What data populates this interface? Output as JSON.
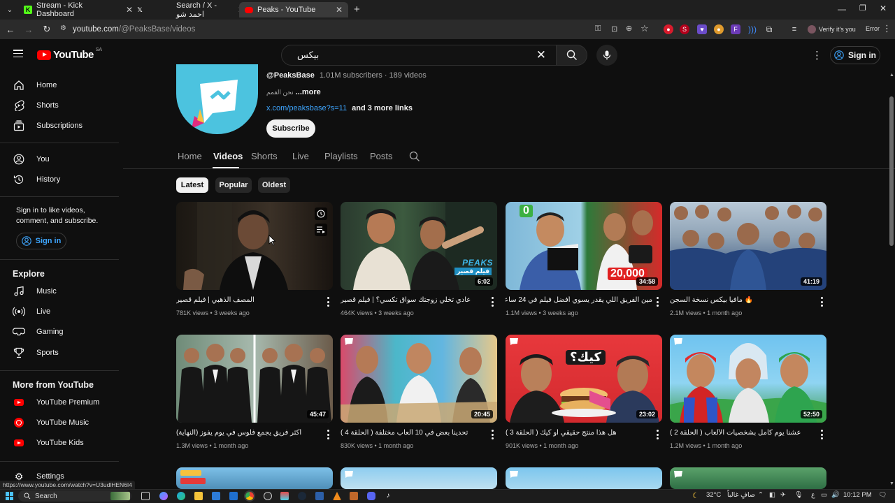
{
  "browser": {
    "tabs": [
      {
        "label": "Stream - Kick Dashboard",
        "favicon": "kick-icon",
        "color": "#53fc18"
      },
      {
        "label": "Search / X - احمد شو",
        "favicon": "x-icon",
        "color": "#ffffff"
      },
      {
        "label": "Peaks - YouTube",
        "favicon": "youtube-icon",
        "color": "#ff0000"
      }
    ],
    "url_host": "youtube.com",
    "url_path": "/@PeaksBase/videos",
    "profile_label": "Verify it's you",
    "error_label": "Error"
  },
  "header": {
    "logo_text": "YouTube",
    "region": "SA",
    "search_value": "بيكس",
    "signin_label": "Sign in"
  },
  "sidebar": {
    "main": [
      {
        "label": "Home",
        "icon": "home-icon"
      },
      {
        "label": "Shorts",
        "icon": "shorts-icon"
      },
      {
        "label": "Subscriptions",
        "icon": "subscriptions-icon"
      }
    ],
    "you": [
      {
        "label": "You",
        "icon": "you-icon"
      },
      {
        "label": "History",
        "icon": "history-icon"
      }
    ],
    "signin_prompt": "Sign in to like videos, comment, and subscribe.",
    "signin_label": "Sign in",
    "explore_title": "Explore",
    "explore": [
      {
        "label": "Music",
        "icon": "music-icon"
      },
      {
        "label": "Live",
        "icon": "live-icon"
      },
      {
        "label": "Gaming",
        "icon": "gaming-icon"
      },
      {
        "label": "Sports",
        "icon": "sports-icon"
      }
    ],
    "more_title": "More from YouTube",
    "more": [
      {
        "label": "YouTube Premium"
      },
      {
        "label": "YouTube Music"
      },
      {
        "label": "YouTube Kids"
      }
    ],
    "settings_label": "Settings"
  },
  "channel": {
    "handle": "@PeaksBase",
    "stats": "1.01M subscribers · 189 videos",
    "description": "نحن القمم",
    "more_label": "...more",
    "link": "x.com/peaksbase?s=11",
    "more_links": "and 3 more links",
    "subscribe_label": "Subscribe",
    "tabs": [
      "Home",
      "Videos",
      "Shorts",
      "Live",
      "Playlists",
      "Posts"
    ],
    "active_tab": "Videos"
  },
  "filters": [
    "Latest",
    "Popular",
    "Oldest"
  ],
  "videos": [
    {
      "title": "المصف الذهبي | فيلم قصير",
      "meta": "781K views • 3 weeks ago",
      "duration": ""
    },
    {
      "title": "عادي تخلي زوجتك سواق تكسي؟ | فيلم قصير",
      "meta": "464K views • 3 weeks ago",
      "duration": "6:02",
      "badge": "PEAKS",
      "badge_sub": "فيلم قصير"
    },
    {
      "title": "مين الفريق اللي يقدر يسوي أفضل فيلم في 24 ساعة ؟",
      "meta": "1.1M views • 3 weeks ago",
      "duration": "34:58",
      "price_low": "0",
      "price_high": "20,000"
    },
    {
      "title": "🔥 مافيا بيكس نسخة السجن",
      "meta": "2.1M views • 1 month ago",
      "duration": "41:19"
    },
    {
      "title": "أكثر فريق يجمع فلوس في يوم يفوز (النهاية)",
      "meta": "1.3M views • 1 month ago",
      "duration": "45:47"
    },
    {
      "title": "تحدينا بعض في 10 ألعاب مختلفة ( الحلقة 4 )",
      "meta": "830K views • 1 month ago",
      "duration": "20:45"
    },
    {
      "title": "هل هذا منتج حقيقي أو كيك ( الحلقة 3 )",
      "meta": "901K views • 1 month ago",
      "duration": "23:02",
      "overlay": "كيك؟"
    },
    {
      "title": "عشنا يوم كامل بشخصيات الألعاب ( الحلقة 2 )",
      "meta": "1.2M views • 1 month ago",
      "duration": "52:50"
    }
  ],
  "status_url": "https://www.youtube.com/watch?v=U3udlHEN6I4",
  "taskbar": {
    "search_label": "Search",
    "weather": "32°C",
    "weather_desc": "صافٍ غالباً",
    "lang": "ع",
    "time": "10:12 PM"
  }
}
